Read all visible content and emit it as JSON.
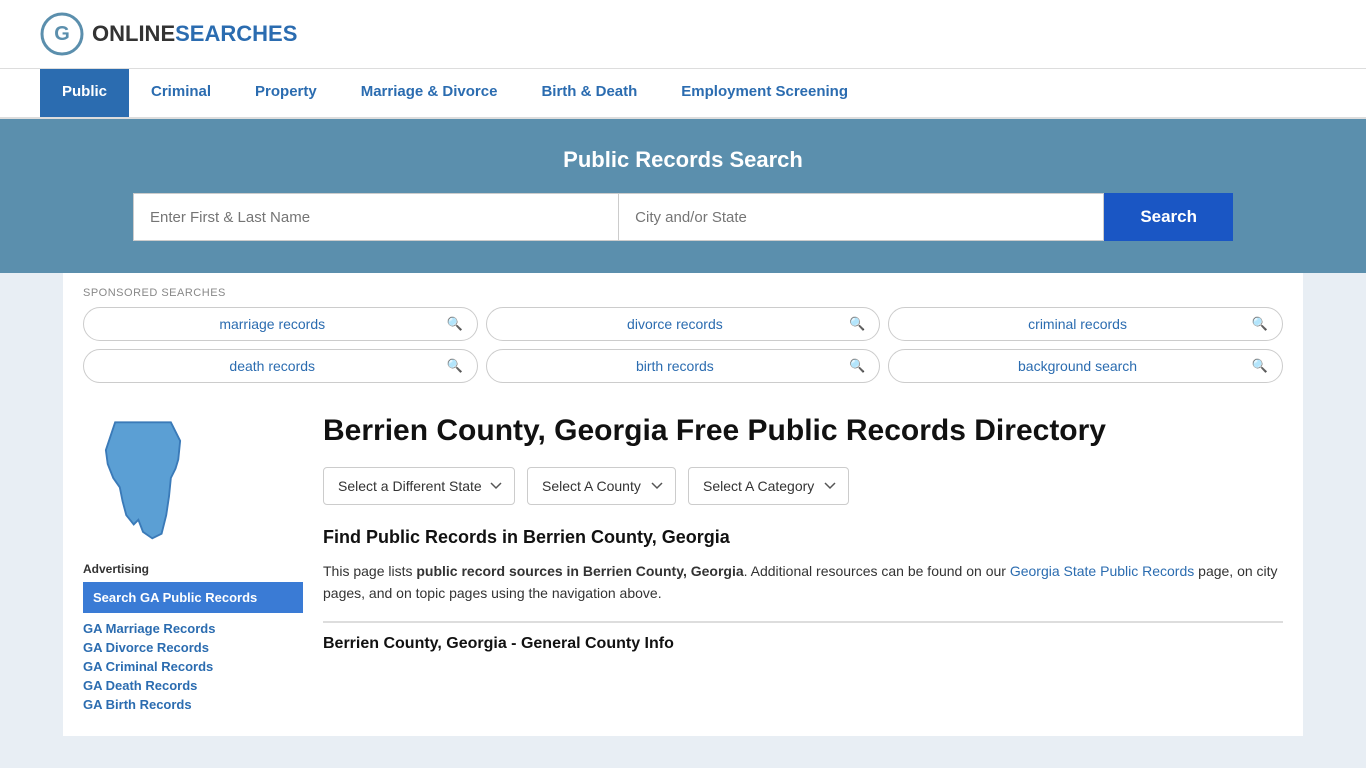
{
  "site": {
    "name_part1": "ONLINE",
    "name_part2": "SEARCHES"
  },
  "nav": {
    "items": [
      {
        "label": "Public",
        "active": true
      },
      {
        "label": "Criminal",
        "active": false
      },
      {
        "label": "Property",
        "active": false
      },
      {
        "label": "Marriage & Divorce",
        "active": false
      },
      {
        "label": "Birth & Death",
        "active": false
      },
      {
        "label": "Employment Screening",
        "active": false
      }
    ]
  },
  "search_banner": {
    "title": "Public Records Search",
    "name_placeholder": "Enter First & Last Name",
    "location_placeholder": "City and/or State",
    "button_label": "Search"
  },
  "sponsored": {
    "label": "SPONSORED SEARCHES",
    "items": [
      {
        "text": "marriage records"
      },
      {
        "text": "divorce records"
      },
      {
        "text": "criminal records"
      },
      {
        "text": "death records"
      },
      {
        "text": "birth records"
      },
      {
        "text": "background search"
      }
    ]
  },
  "page": {
    "title": "Berrien County, Georgia Free Public Records Directory",
    "dropdowns": {
      "state": "Select a Different State",
      "county": "Select A County",
      "category": "Select A Category"
    },
    "find_title": "Find Public Records in Berrien County, Georgia",
    "find_text_before": "This page lists ",
    "find_text_bold": "public record sources in Berrien County, Georgia",
    "find_text_after": ". Additional resources can be found on our ",
    "find_link_text": "Georgia State Public Records",
    "find_text_end": " page, on city pages, and on topic pages using the navigation above.",
    "section_sub_title": "Berrien County, Georgia - General County Info"
  },
  "sidebar": {
    "ad_label": "Advertising",
    "ad_item": "Search GA Public Records",
    "links": [
      {
        "label": "GA Marriage Records"
      },
      {
        "label": "GA Divorce Records"
      },
      {
        "label": "GA Criminal Records"
      },
      {
        "label": "GA Death Records"
      },
      {
        "label": "GA Birth Records"
      }
    ]
  }
}
